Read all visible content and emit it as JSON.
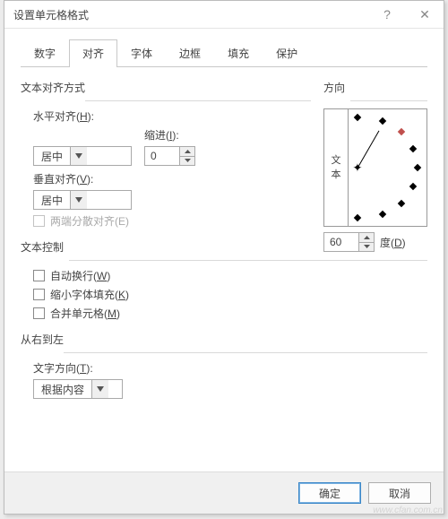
{
  "window": {
    "title": "设置单元格格式"
  },
  "tabs": {
    "items": [
      {
        "label": "数字"
      },
      {
        "label": "对齐"
      },
      {
        "label": "字体"
      },
      {
        "label": "边框"
      },
      {
        "label": "填充"
      },
      {
        "label": "保护"
      }
    ],
    "active_index": 1
  },
  "align": {
    "group_title": "文本对齐方式",
    "h_label": "水平对齐(H):",
    "h_value": "居中",
    "v_label": "垂直对齐(V):",
    "v_value": "居中",
    "indent_label": "缩进(I):",
    "indent_value": "0",
    "justify_distributed_label": "两端分散对齐(E)"
  },
  "orientation": {
    "group_title": "方向",
    "vertical_text_a": "文",
    "vertical_text_b": "本",
    "degrees_value": "60",
    "degrees_label": "度(D)"
  },
  "text_control": {
    "group_title": "文本控制",
    "wrap_label": "自动换行(W)",
    "shrink_label": "缩小字体填充(K)",
    "merge_label": "合并单元格(M)"
  },
  "r2l": {
    "group_title": "从右到左",
    "dir_label": "文字方向(T):",
    "dir_value": "根据内容"
  },
  "footer": {
    "ok_label": "确定",
    "cancel_label": "取消"
  },
  "watermark": "www.cfan.com.cn"
}
